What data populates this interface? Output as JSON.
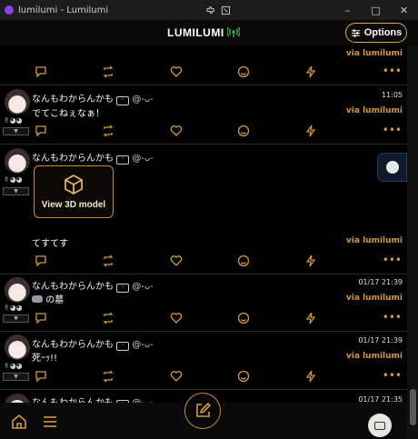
{
  "window": {
    "title": "lumilumi - Lumilumi",
    "controls": {
      "minimize": "–",
      "maximize": "□",
      "close": "✕"
    }
  },
  "header": {
    "brand": "LUMILUMI",
    "options_label": "Options"
  },
  "colors": {
    "accent": "#d49a3e",
    "background": "#000000",
    "text": "#e8e8e8"
  },
  "posts": [
    {
      "id": "p0",
      "partial": true,
      "via": "via lumilumi"
    },
    {
      "id": "p1",
      "name": "なんもわからんかも",
      "handle": "@-ᴗ-",
      "timestamp": "11:05",
      "text": "でてこねぇなぁ！",
      "via": "via lumilumi"
    },
    {
      "id": "p2",
      "name": "なんもわからんかも",
      "handle": "@-ᴗ-",
      "timestamp": "",
      "media_button": "View 3D model",
      "text": "てすてす",
      "via": "via lumilumi"
    },
    {
      "id": "p3",
      "name": "なんもわからんかも",
      "handle": "@-ᴗ-",
      "timestamp": "01/17 21:39",
      "text": "の墓",
      "via": "via lumilumi"
    },
    {
      "id": "p4",
      "name": "なんもわからんかも",
      "handle": "@-ᴗ-",
      "timestamp": "01/17 21:39",
      "text": "死ｰｯ!!",
      "via": "via lumilumi"
    },
    {
      "id": "p5",
      "name": "なんもわからんかも",
      "handle": "@-ᴗ-",
      "timestamp": "01/17 21:35"
    }
  ],
  "actions": {
    "icons": [
      "reply-icon",
      "repost-icon",
      "heart-icon",
      "reaction-icon",
      "zap-icon",
      "more-icon"
    ]
  },
  "bottom_nav": {
    "home_icon": "home-icon",
    "menu_icon": "menu-icon",
    "compose_icon": "compose-icon",
    "account_icon": "account-avatar"
  }
}
